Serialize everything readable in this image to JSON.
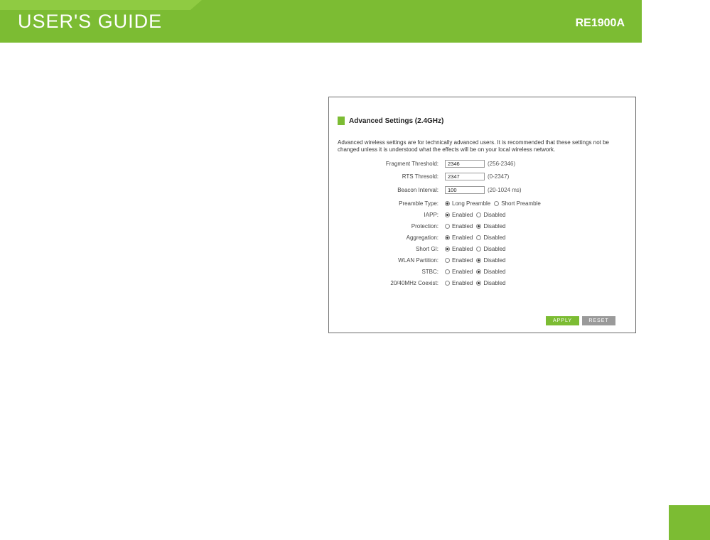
{
  "header": {
    "title": "USER'S GUIDE",
    "model": "RE1900A",
    "colors": {
      "brand_green": "#7cbc33"
    }
  },
  "panel": {
    "title": "Advanced Settings (2.4GHz)",
    "description": "Advanced wireless settings are for technically advanced users. It is recommended that these settings not be changed unless it is understood what the effects will be on your local wireless network.",
    "fields": {
      "fragment": {
        "label": "Fragment Threshold:",
        "value": "2346",
        "range": "(256-2346)"
      },
      "rts": {
        "label": "RTS Thresold:",
        "value": "2347",
        "range": "(0-2347)"
      },
      "beacon": {
        "label": "Beacon Interval:",
        "value": "100",
        "range": "(20-1024 ms)"
      }
    },
    "preamble": {
      "label": "Preamble Type:",
      "option1": "Long Preamble",
      "option2": "Short Preamble",
      "selected": "Long Preamble"
    },
    "toggles": [
      {
        "label": "IAPP:",
        "enabled": "Enabled",
        "disabled": "Disabled",
        "selected": "Enabled"
      },
      {
        "label": "Protection:",
        "enabled": "Enabled",
        "disabled": "Disabled",
        "selected": "Disabled"
      },
      {
        "label": "Aggregation:",
        "enabled": "Enabled",
        "disabled": "Disabled",
        "selected": "Enabled"
      },
      {
        "label": "Short GI:",
        "enabled": "Enabled",
        "disabled": "Disabled",
        "selected": "Enabled"
      },
      {
        "label": "WLAN Partition:",
        "enabled": "Enabled",
        "disabled": "Disabled",
        "selected": "Disabled"
      },
      {
        "label": "STBC:",
        "enabled": "Enabled",
        "disabled": "Disabled",
        "selected": "Disabled"
      },
      {
        "label": "20/40MHz Coexist:",
        "enabled": "Enabled",
        "disabled": "Disabled",
        "selected": "Disabled"
      }
    ],
    "buttons": {
      "apply": "APPLY",
      "reset": "RESET"
    }
  }
}
